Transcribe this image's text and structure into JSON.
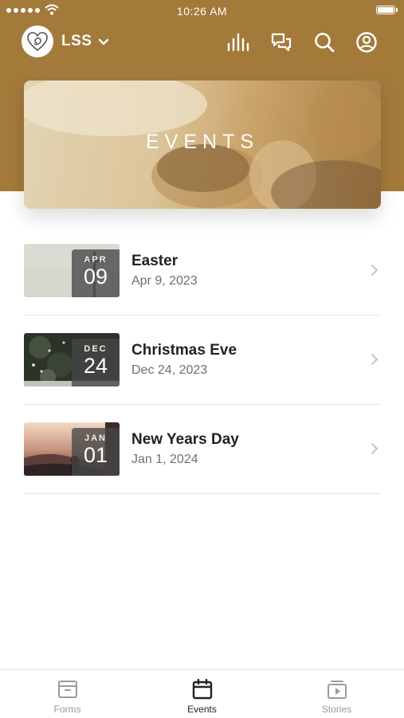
{
  "status_bar": {
    "time": "10:26 AM"
  },
  "header": {
    "org_name": "LSS",
    "accent_color": "#a47a3b",
    "icons": [
      "bar-chart-icon",
      "chat-icon",
      "search-icon",
      "profile-icon"
    ]
  },
  "hero": {
    "title": "EVENTS"
  },
  "events": [
    {
      "month": "APR",
      "day": "09",
      "title": "Easter",
      "date": "Apr 9, 2023"
    },
    {
      "month": "DEC",
      "day": "24",
      "title": "Christmas Eve",
      "date": "Dec 24, 2023"
    },
    {
      "month": "JAN",
      "day": "01",
      "title": "New Years Day",
      "date": "Jan 1, 2024"
    }
  ],
  "tab_bar": {
    "tabs": [
      {
        "label": "Forms",
        "icon": "archive-box-icon",
        "active": false
      },
      {
        "label": "Events",
        "icon": "calendar-icon",
        "active": true
      },
      {
        "label": "Stories",
        "icon": "play-stack-icon",
        "active": false
      }
    ]
  }
}
